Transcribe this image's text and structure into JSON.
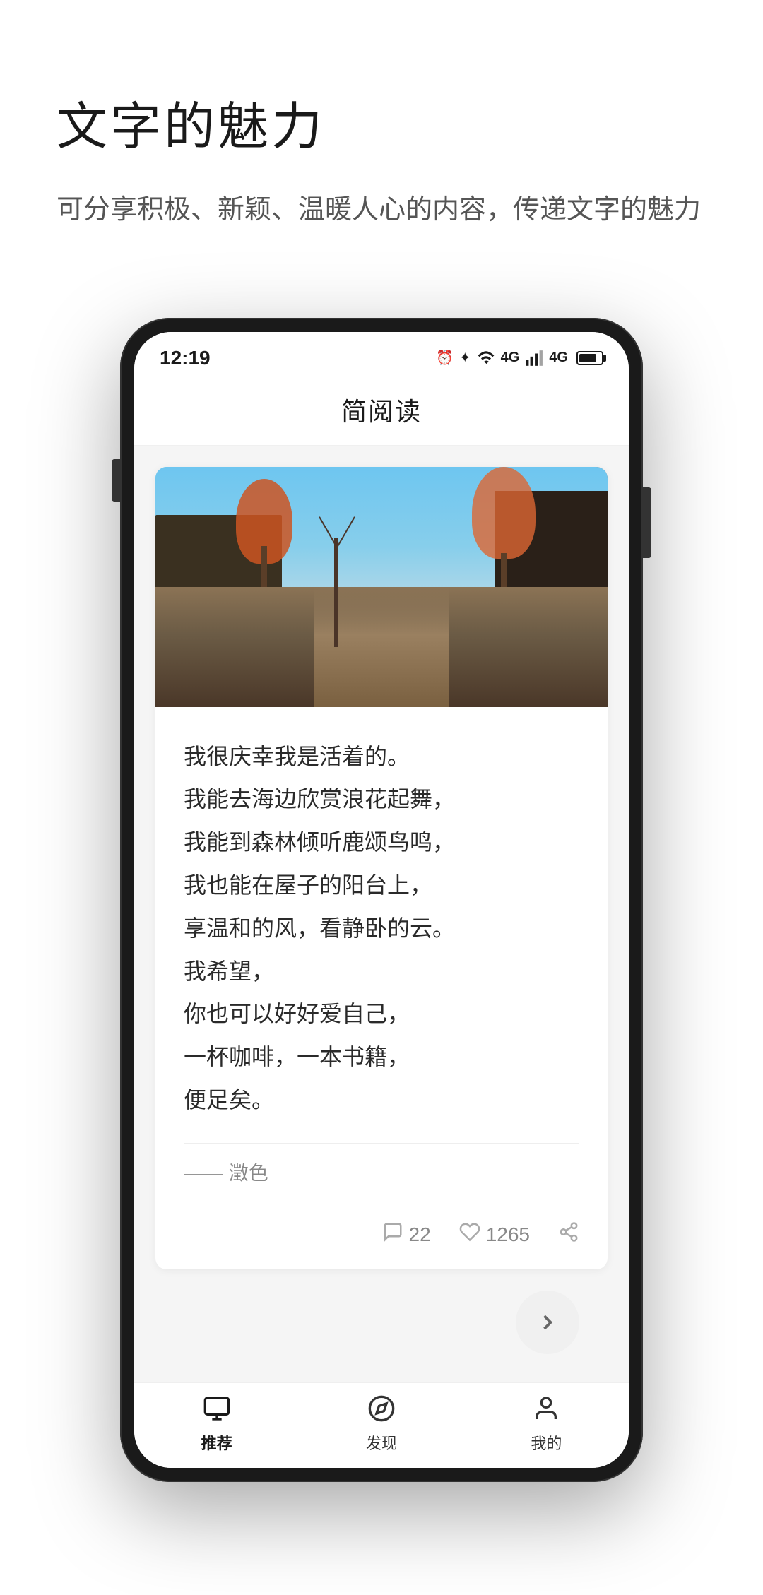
{
  "page": {
    "main_title": "文字的魅力",
    "sub_title": "可分享积极、新颖、温暖人心的内容，传递文字的魅力"
  },
  "phone": {
    "status_bar": {
      "time": "12:19",
      "nfc_icon": "N",
      "icons_right": "🔔 ✦ ☁ ▲ 4G 4G"
    },
    "app_header": {
      "title": "简阅读"
    },
    "card": {
      "text_lines": [
        "我很庆幸我是活着的。",
        "我能去海边欣赏浪花起舞，",
        "我能到森林倾听鹿颂鸟鸣，",
        "我也能在屋子的阳台上，",
        "享温和的风，看静卧的云。",
        "我希望，",
        "你也可以好好爱自己，",
        "一杯咖啡，一本书籍，",
        "便足矣。"
      ],
      "author": "—— 澂色",
      "comment_count": "22",
      "like_count": "1265"
    },
    "bottom_nav": {
      "items": [
        {
          "label": "推荐",
          "icon": "monitor",
          "active": true
        },
        {
          "label": "发现",
          "icon": "compass",
          "active": false
        },
        {
          "label": "我的",
          "icon": "user",
          "active": false
        }
      ]
    }
  }
}
